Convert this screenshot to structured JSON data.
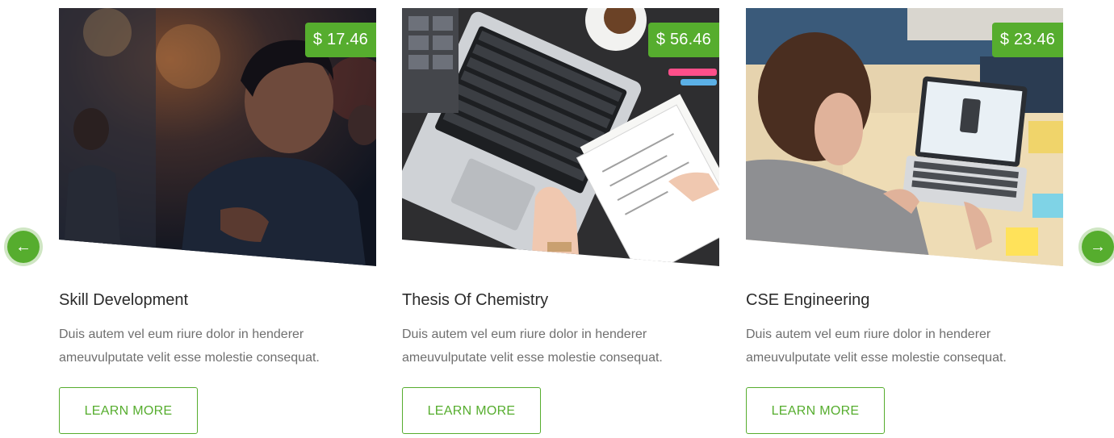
{
  "carousel": {
    "prev_icon": "arrow-left-icon",
    "next_icon": "arrow-right-icon",
    "prev_glyph": "←",
    "next_glyph": "→",
    "accent_color": "#56ad2e"
  },
  "courses": [
    {
      "price": "$ 17.46",
      "title": "Skill Development",
      "description": "Duis autem vel eum riure dolor in henderer ameuvulputate velit esse molestie consequat.",
      "button_label": "LEARN MORE"
    },
    {
      "price": "$ 56.46",
      "title": "Thesis Of Chemistry",
      "description": "Duis autem vel eum riure dolor in henderer ameuvulputate velit esse molestie consequat.",
      "button_label": "LEARN MORE"
    },
    {
      "price": "$ 23.46",
      "title": "CSE Engineering",
      "description": "Duis autem vel eum riure dolor in henderer ameuvulputate velit esse molestie consequat.",
      "button_label": "LEARN MORE"
    }
  ]
}
